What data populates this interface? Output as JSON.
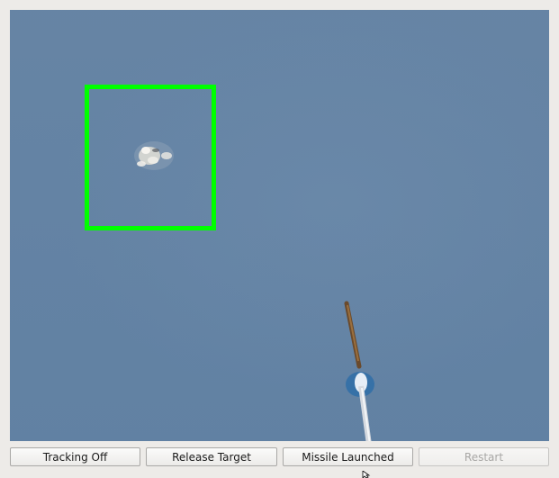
{
  "buttons": {
    "tracking": "Tracking Off",
    "release": "Release Target",
    "missile": "Missile Launched",
    "restart": "Restart"
  },
  "colors": {
    "sky": "#6383a4",
    "target_box": "#00ff00",
    "disabled_text": "#a8a7a5"
  },
  "icons": {
    "cursor": "mouse-pointer-icon"
  }
}
